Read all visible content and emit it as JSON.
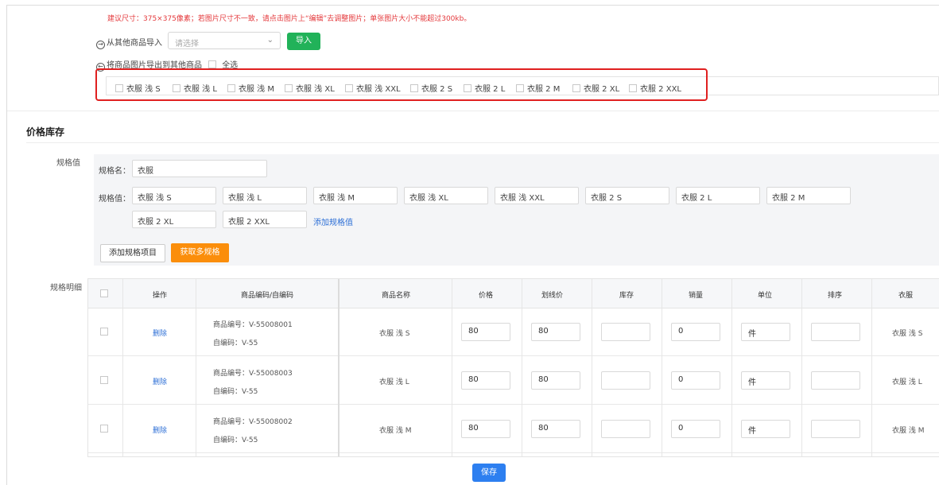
{
  "hint": "建议尺寸：375×375像素；若图片尺寸不一致，请点击图片上“编辑”去调整图片；单张图片大小不能超过300kb。",
  "import": {
    "label": "从其他商品导入",
    "select_placeholder": "请选择",
    "button": "导入"
  },
  "export": {
    "label": "将商品图片导出到其他商品",
    "select_all": "全选",
    "items": [
      "衣服 浅 S",
      "衣服 浅 L",
      "衣服 浅 M",
      "衣服 浅 XL",
      "衣服 浅 XXL",
      "衣服 2 S",
      "衣服 2 L",
      "衣服 2 M",
      "衣服 2 XL",
      "衣服 2 XXL"
    ]
  },
  "section_title": "价格库存",
  "spec": {
    "side_label": "规格值",
    "name_label": "规格名：",
    "name_value": "衣服",
    "values_label": "规格值：",
    "values": [
      "衣服 浅 S",
      "衣服 浅 L",
      "衣服 浅 M",
      "衣服 浅 XL",
      "衣服 浅 XXL",
      "衣服 2 S",
      "衣服 2 L",
      "衣服 2 M",
      "衣服 2 XL",
      "衣服 2 XXL"
    ],
    "add_value": "添加规格值",
    "add_item_button": "添加规格项目",
    "get_multi_button": "获取多规格"
  },
  "detail": {
    "side_label": "规格明细",
    "headers": [
      "操作",
      "商品编码/自编码",
      "商品名称",
      "价格",
      "划线价",
      "库存",
      "销量",
      "单位",
      "排序",
      "衣服"
    ],
    "rows": [
      {
        "action": "删除",
        "code": "商品编号：V-55008001",
        "self_code": "自编码：V-55",
        "name": "衣服 浅 S",
        "price": "80",
        "line_price": "80",
        "stock": "",
        "sales": "0",
        "unit": "件",
        "sort": "",
        "spec": "衣服 浅 S"
      },
      {
        "action": "删除",
        "code": "商品编号：V-55008003",
        "self_code": "自编码：V-55",
        "name": "衣服 浅 L",
        "price": "80",
        "line_price": "80",
        "stock": "",
        "sales": "0",
        "unit": "件",
        "sort": "",
        "spec": "衣服 浅 L"
      },
      {
        "action": "删除",
        "code": "商品编号：V-55008002",
        "self_code": "自编码：V-55",
        "name": "衣服 浅 M",
        "price": "80",
        "line_price": "80",
        "stock": "",
        "sales": "0",
        "unit": "件",
        "sort": "",
        "spec": "衣服 浅 M"
      }
    ]
  },
  "save_button": "保存",
  "colors": {
    "accent_blue": "#2d7ff0",
    "green": "#21b259",
    "orange": "#fb8e0b",
    "warning_red": "#e4393c"
  }
}
